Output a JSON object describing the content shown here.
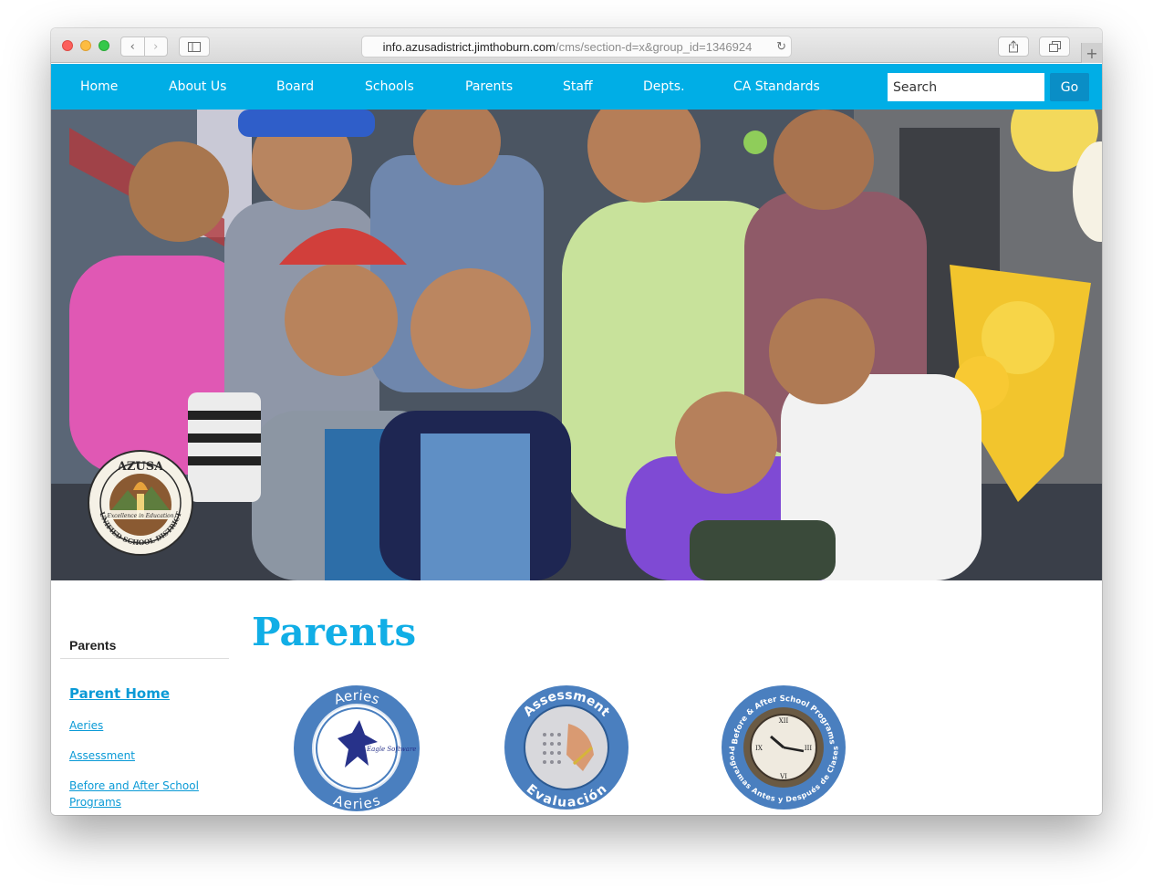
{
  "browser": {
    "url_domain": "info.azusadistrict.jimthoburn.com",
    "url_path": "/cms/section-d=x&group_id=1346924"
  },
  "nav": {
    "items": [
      {
        "label": "Home"
      },
      {
        "label": "About Us"
      },
      {
        "label": "Board"
      },
      {
        "label": "Schools"
      },
      {
        "label": "Parents"
      },
      {
        "label": "Staff"
      },
      {
        "label": "Depts."
      },
      {
        "label": "CA Standards"
      }
    ],
    "search_placeholder": "Search",
    "go_label": "Go"
  },
  "hero": {
    "seal_top_text": "AZUSA",
    "seal_ring_text": "UNIFIED SCHOOL DISTRICT",
    "seal_motto": "Excellence in Education"
  },
  "sidebar": {
    "title": "Parents",
    "links": [
      {
        "label": "Parent Home"
      },
      {
        "label": "Aeries"
      },
      {
        "label": "Assessment"
      },
      {
        "label": "Before and After School Programs"
      }
    ]
  },
  "main": {
    "title": "Parents",
    "badges": [
      {
        "top": "Aeries",
        "bottom": "Aeries",
        "inner": "Eagle Software"
      },
      {
        "top": "Assessment",
        "bottom": "Evaluación"
      },
      {
        "top": "Before & After School Programs",
        "bottom": "Programas Antes y Después de Clases"
      }
    ]
  },
  "colors": {
    "nav_bg": "#00aee6",
    "go_bg": "#0a8ec6",
    "title": "#11aee6",
    "badge_ring": "#4a7fbf"
  }
}
